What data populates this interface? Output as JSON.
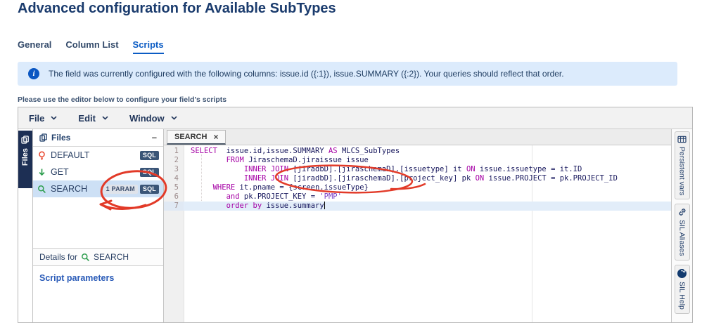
{
  "page": {
    "title": "Advanced configuration for Available SubTypes"
  },
  "tabs": [
    {
      "label": "General",
      "active": false
    },
    {
      "label": "Column List",
      "active": false
    },
    {
      "label": "Scripts",
      "active": true
    }
  ],
  "banner": {
    "icon": "info-icon",
    "text": "The field was currently configured with the following columns: issue.id ({:1}), issue.SUMMARY ({:2}). Your queries should reflect that order."
  },
  "hint": "Please use the editor below to configure your field's scripts",
  "menu": {
    "items": [
      "File",
      "Edit",
      "Window"
    ]
  },
  "files_panel": {
    "vertical_tab": "Files",
    "title": "Files",
    "minimize_label": "–",
    "files": [
      {
        "name": "DEFAULT",
        "icon": "lightbulb-icon",
        "selected": false,
        "badges": [
          {
            "label": "SQL",
            "type": "sql"
          }
        ]
      },
      {
        "name": "GET",
        "icon": "arrow-down-icon",
        "selected": false,
        "badges": [
          {
            "label": "SQL",
            "type": "sql"
          }
        ]
      },
      {
        "name": "SEARCH",
        "icon": "search-icon",
        "selected": true,
        "badges": [
          {
            "label": "1 PARAM",
            "type": "param"
          },
          {
            "label": "SQL",
            "type": "sql"
          }
        ]
      }
    ],
    "details": {
      "prefix": "Details for",
      "file": "SEARCH",
      "file_icon": "search-icon",
      "partial_text": "Script parameters"
    }
  },
  "editor": {
    "tab": {
      "label": "SEARCH",
      "close": "×"
    },
    "lines": [
      {
        "no": 1,
        "tokens": [
          [
            "kw",
            "SELECT"
          ],
          [
            "id",
            "  issue.id,issue.SUMMARY "
          ],
          [
            "kw",
            "AS"
          ],
          [
            "id",
            " MLCS_SubTypes"
          ]
        ]
      },
      {
        "no": 2,
        "tokens": [
          [
            "id",
            "        "
          ],
          [
            "kw",
            "FROM"
          ],
          [
            "id",
            " JiraschemaD.jiraissue issue"
          ]
        ]
      },
      {
        "no": 3,
        "tokens": [
          [
            "id",
            "            "
          ],
          [
            "kw",
            "INNER JOIN"
          ],
          [
            "id",
            " [jiradbD].[jiraschemaD].[issuetype] it "
          ],
          [
            "kw",
            "ON"
          ],
          [
            "id",
            " issue.issuetype = it.ID"
          ]
        ]
      },
      {
        "no": 4,
        "tokens": [
          [
            "id",
            "            "
          ],
          [
            "kw",
            "INNER JOIN"
          ],
          [
            "id",
            " [jiradbD].[jiraschemaD].[project_key] pk "
          ],
          [
            "kw",
            "ON"
          ],
          [
            "id",
            " issue.PROJECT = pk.PROJECT_ID"
          ]
        ]
      },
      {
        "no": 5,
        "tokens": [
          [
            "id",
            "     "
          ],
          [
            "kw",
            "WHERE"
          ],
          [
            "id",
            " it.pname = {screen.issueType}"
          ]
        ]
      },
      {
        "no": 6,
        "tokens": [
          [
            "id",
            "        "
          ],
          [
            "kw",
            "and"
          ],
          [
            "id",
            " pk.PROJECT_KEY = "
          ],
          [
            "str",
            "'PMP'"
          ]
        ]
      },
      {
        "no": 7,
        "current": true,
        "tokens": [
          [
            "id",
            "        "
          ],
          [
            "kw",
            "order by"
          ],
          [
            "id",
            " issue.summary"
          ],
          [
            "caret",
            ""
          ]
        ]
      }
    ]
  },
  "right_tabs": [
    {
      "label": "Persistent vars",
      "icon": "vars-icon"
    },
    {
      "label": "SIL Aliases",
      "icon": "link-icon"
    },
    {
      "label": "SIL Help",
      "icon": "help-icon"
    }
  ],
  "colors": {
    "accent_blue": "#0b5cc4",
    "title_navy": "#1a3b6d",
    "banner_bg": "#dcebfc",
    "selected_row": "#cde0f5",
    "sql_badge_bg": "#3a5577",
    "keyword": "#a500a5",
    "identifier": "#16165c",
    "string": "#7a3fc6",
    "annotation_red": "#e23a28",
    "icon_green": "#2f9e4f",
    "icon_orange": "#e8432b"
  }
}
